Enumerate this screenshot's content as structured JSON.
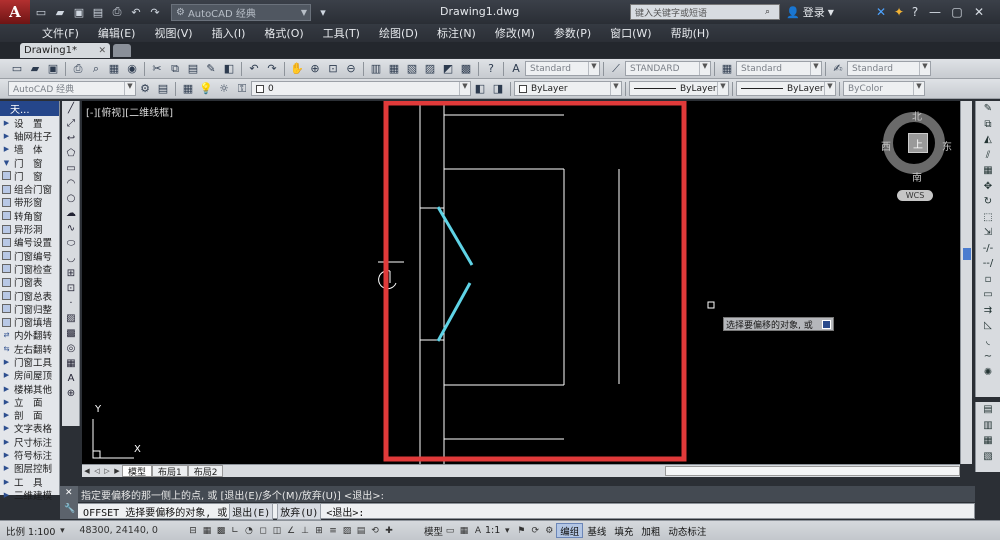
{
  "titlebar": {
    "app_logo": "A",
    "workspace": "AutoCAD 经典",
    "doc_title": "Drawing1.dwg",
    "search_placeholder": "键入关键字或短语",
    "login": "登录"
  },
  "menu": [
    "文件(F)",
    "编辑(E)",
    "视图(V)",
    "插入(I)",
    "格式(O)",
    "工具(T)",
    "绘图(D)",
    "标注(N)",
    "修改(M)",
    "参数(P)",
    "窗口(W)",
    "帮助(H)"
  ],
  "tabs": {
    "doc_tab": "Drawing1*"
  },
  "toolbar1": {
    "text_style": "Standard",
    "dim_style": "STANDARD",
    "table_style": "Standard",
    "mleader_style": "Standard"
  },
  "toolbar2": {
    "workspace": "AutoCAD 经典",
    "layer": "0",
    "color": "ByLayer",
    "linetype": "ByLayer",
    "lineweight": "ByLayer",
    "plotstyle": "ByColor"
  },
  "palette": {
    "header": "天...",
    "items": [
      "设　置",
      "轴网柱子",
      "墙　体",
      "门　窗",
      "门　窗",
      "组合门窗",
      "带形窗",
      "转角窗",
      "异形洞",
      "编号设置",
      "门窗编号",
      "门窗检查",
      "门窗表",
      "门窗总表",
      "门窗归整",
      "门窗填墙",
      "内外翻转",
      "左右翻转",
      "门窗工具",
      "房间屋顶",
      "楼梯其他",
      "立　面",
      "剖　面",
      "文字表格",
      "尺寸标注",
      "符号标注",
      "图层控制",
      "工　具",
      "三维建模"
    ]
  },
  "canvas": {
    "viewport_label": "[-][俯视][二维线框]",
    "compass": {
      "north": "北",
      "south": "南",
      "east": "东",
      "west": "西",
      "top": "上"
    },
    "wcs": "WCS",
    "ucs_x": "X",
    "ucs_y": "Y",
    "tooltip": "选择要偏移的对象, 或"
  },
  "layout_tabs": [
    "模型",
    "布局1",
    "布局2"
  ],
  "command": {
    "history": "指定要偏移的那一侧上的点, 或 [退出(E)/多个(M)/放弃(U)] <退出>:",
    "prompt_cmd": "OFFSET 选择要偏移的对象, 或",
    "opt_exit": "退出(E)",
    "opt_undo": "放弃(U)",
    "prompt_tail": "<退出>:"
  },
  "status": {
    "scale": "比例 1:100",
    "coords": "48300, 24140, 0",
    "model": "模型",
    "anno_scale": "1:1",
    "buttons": [
      {
        "label": "编组",
        "on": true
      },
      {
        "label": "基线",
        "on": false
      },
      {
        "label": "填充",
        "on": false
      },
      {
        "label": "加粗",
        "on": false
      },
      {
        "label": "动态标注",
        "on": false
      }
    ]
  },
  "colors": {
    "highlight_rect": "#e03a3a",
    "door_leaf": "#5fd3e6",
    "lines": "#ffffff"
  }
}
